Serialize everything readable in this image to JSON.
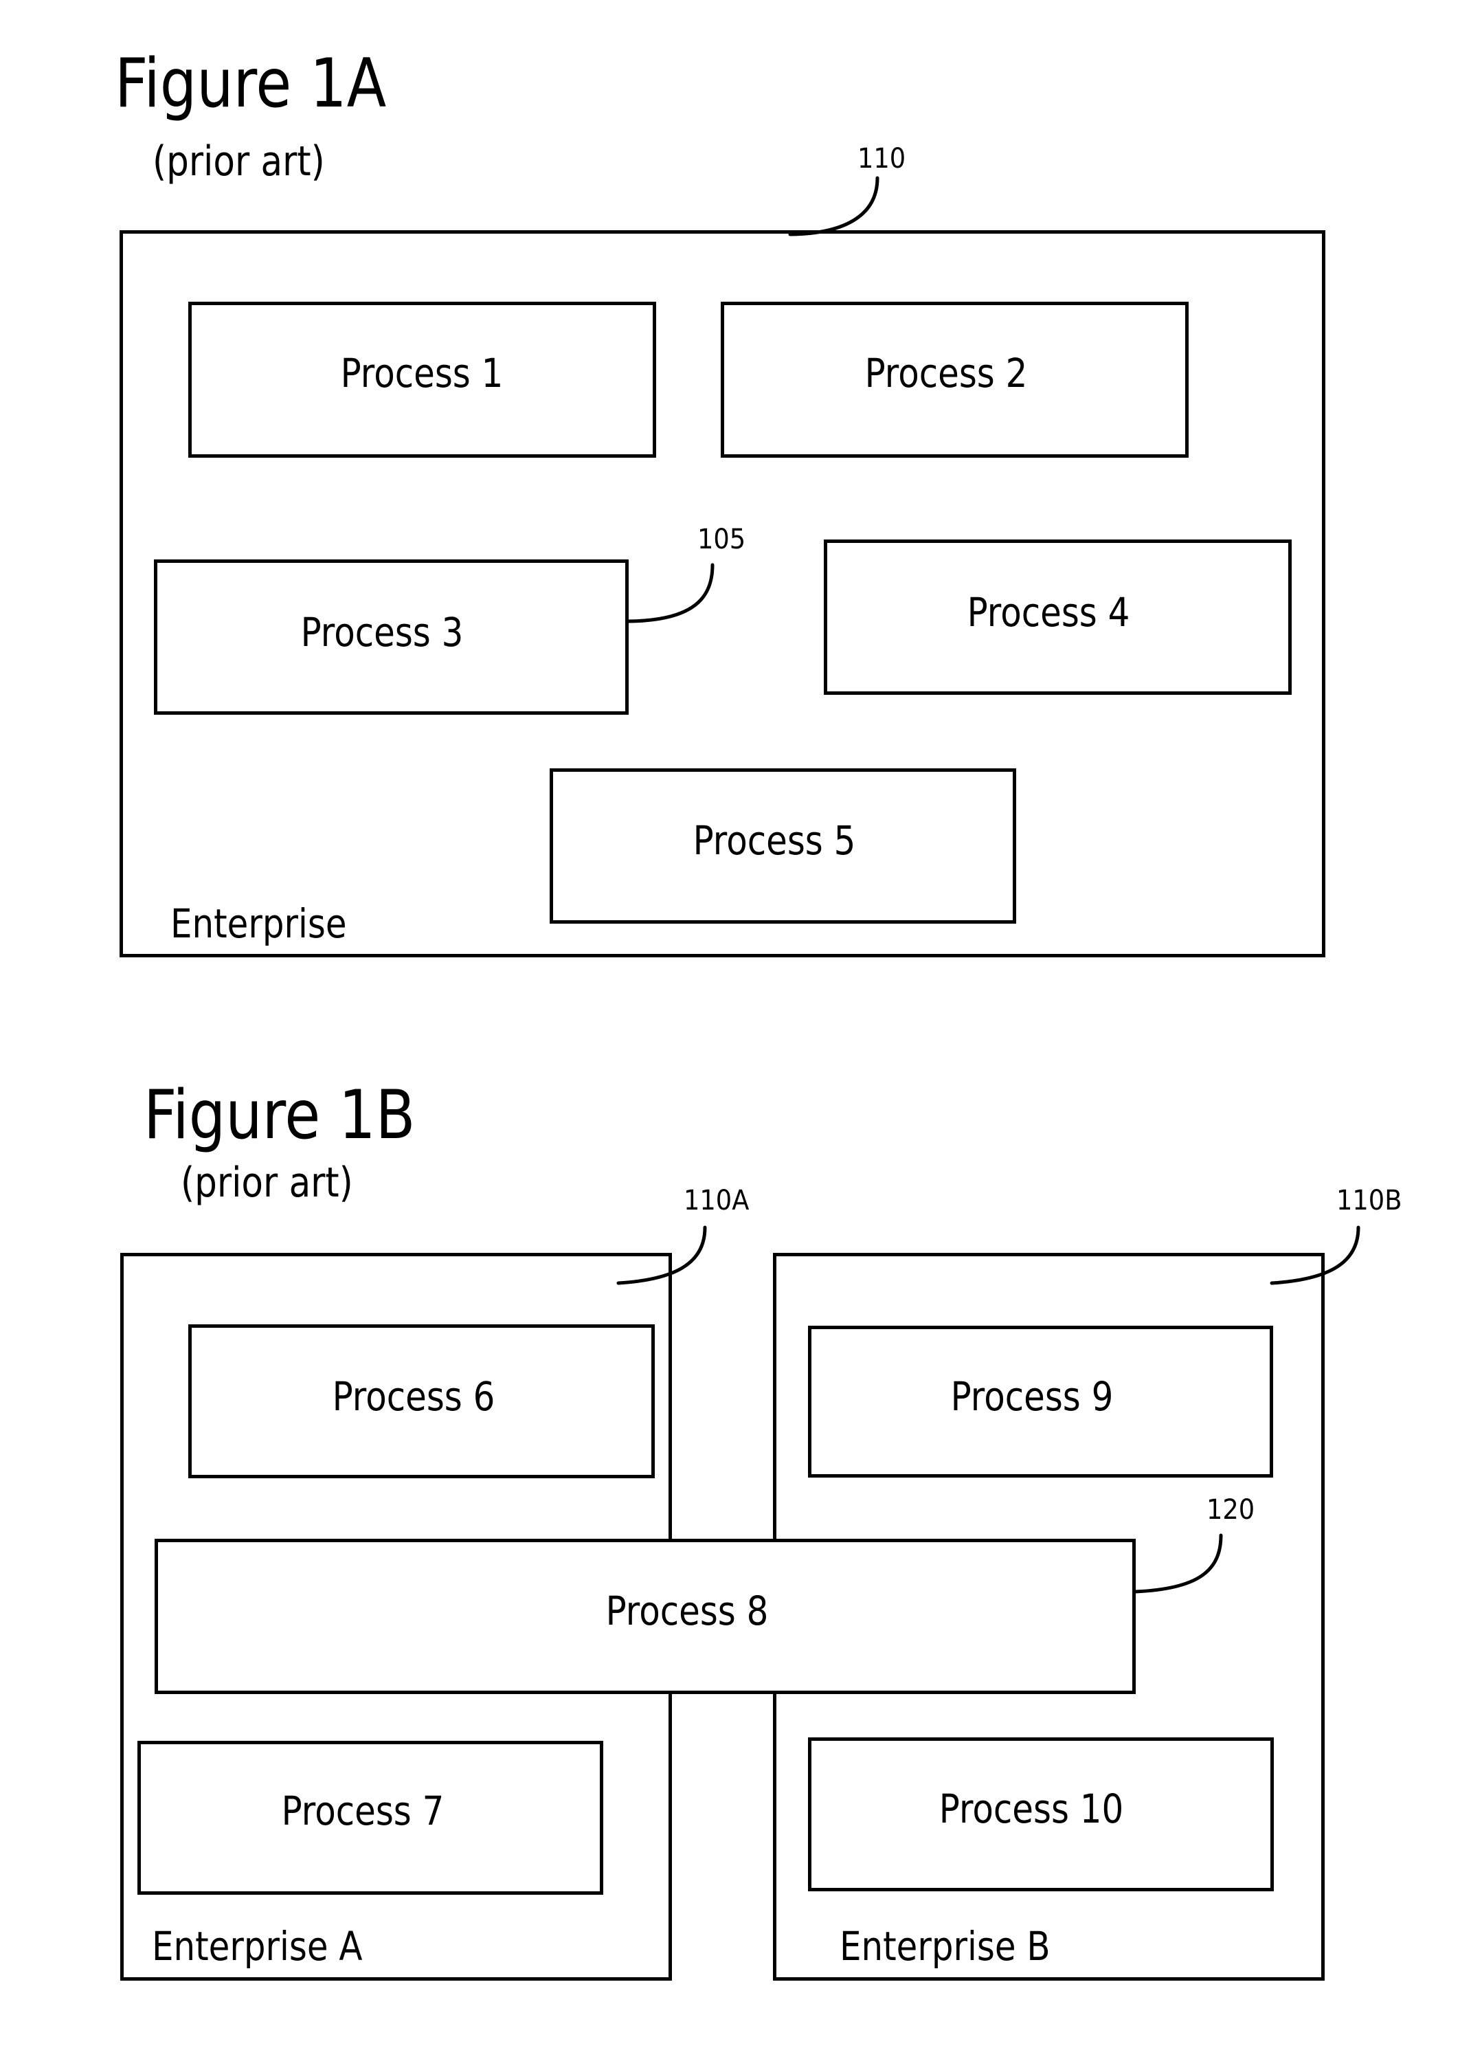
{
  "figure_1a": {
    "title": "Figure 1A",
    "subtitle": "(prior art)",
    "enterprise": {
      "label": "Enterprise",
      "ref": "110"
    },
    "processes": [
      {
        "label": "Process 1"
      },
      {
        "label": "Process 2"
      },
      {
        "label": "Process 3",
        "ref": "105"
      },
      {
        "label": "Process 4"
      },
      {
        "label": "Process 5"
      }
    ]
  },
  "figure_1b": {
    "title": "Figure 1B",
    "subtitle": "(prior art)",
    "enterprises": [
      {
        "label": "Enterprise A",
        "ref": "110A"
      },
      {
        "label": "Enterprise B",
        "ref": "110B"
      }
    ],
    "processes": [
      {
        "label": "Process 6"
      },
      {
        "label": "Process 7"
      },
      {
        "label": "Process 8",
        "ref": "120"
      },
      {
        "label": "Process 9"
      },
      {
        "label": "Process 10"
      }
    ]
  }
}
